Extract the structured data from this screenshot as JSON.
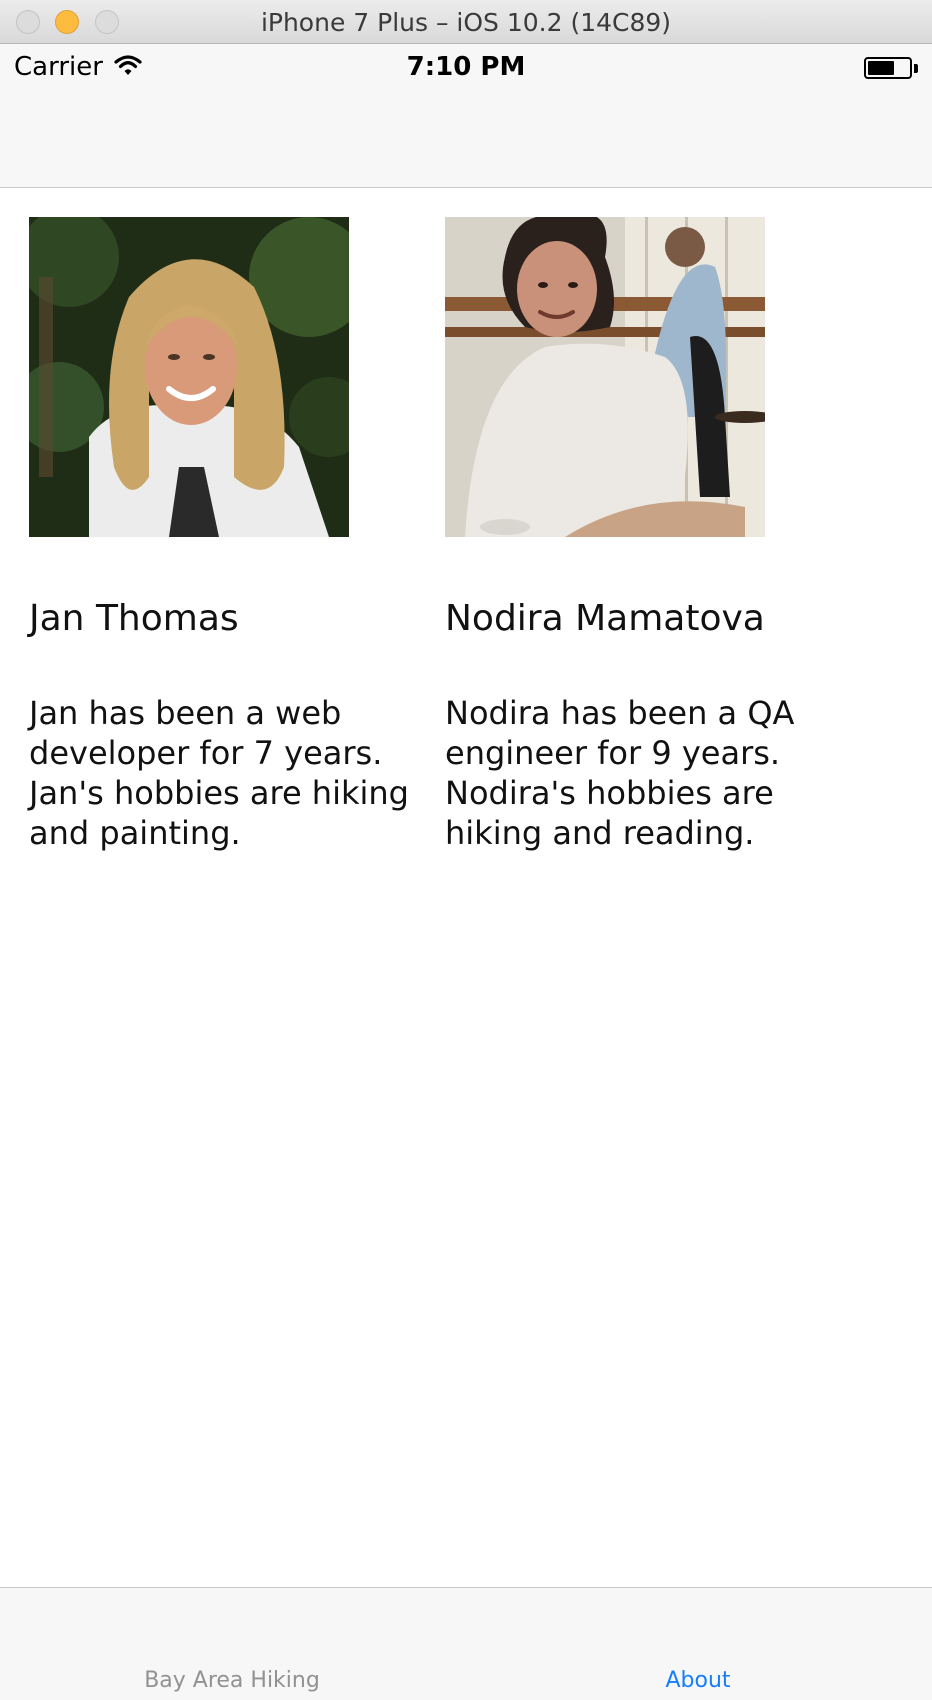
{
  "window": {
    "title": "iPhone 7 Plus – iOS 10.2 (14C89)"
  },
  "status_bar": {
    "carrier": "Carrier",
    "time": "7:10 PM",
    "icons": [
      "wifi-icon",
      "battery-icon"
    ]
  },
  "people": [
    {
      "name": "Jan Thomas",
      "bio": "Jan has been a web developer for 7 years. Jan's hobbies are hiking and painting."
    },
    {
      "name": "Nodira Mamatova",
      "bio": "Nodira has been a QA engineer for 9 years. Nodira's hobbies are hiking and reading."
    }
  ],
  "tab_bar": {
    "tabs": [
      {
        "label": "Bay Area Hiking",
        "selected": false
      },
      {
        "label": "About",
        "selected": true
      }
    ],
    "selected_color": "#147efb",
    "unselected_color": "#929292"
  }
}
